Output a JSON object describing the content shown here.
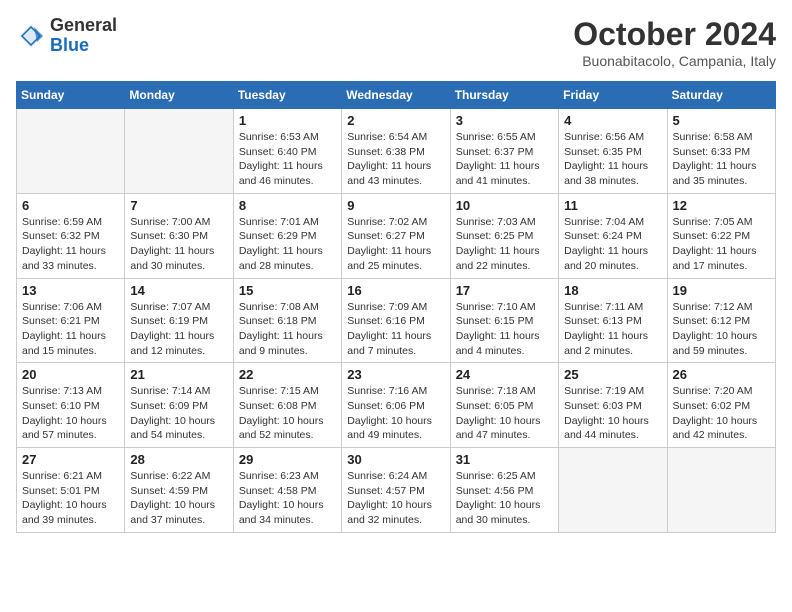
{
  "header": {
    "logo_general": "General",
    "logo_blue": "Blue",
    "month": "October 2024",
    "location": "Buonabitacolo, Campania, Italy"
  },
  "weekdays": [
    "Sunday",
    "Monday",
    "Tuesday",
    "Wednesday",
    "Thursday",
    "Friday",
    "Saturday"
  ],
  "weeks": [
    [
      {
        "day": "",
        "info": ""
      },
      {
        "day": "",
        "info": ""
      },
      {
        "day": "1",
        "info": "Sunrise: 6:53 AM\nSunset: 6:40 PM\nDaylight: 11 hours and 46 minutes."
      },
      {
        "day": "2",
        "info": "Sunrise: 6:54 AM\nSunset: 6:38 PM\nDaylight: 11 hours and 43 minutes."
      },
      {
        "day": "3",
        "info": "Sunrise: 6:55 AM\nSunset: 6:37 PM\nDaylight: 11 hours and 41 minutes."
      },
      {
        "day": "4",
        "info": "Sunrise: 6:56 AM\nSunset: 6:35 PM\nDaylight: 11 hours and 38 minutes."
      },
      {
        "day": "5",
        "info": "Sunrise: 6:58 AM\nSunset: 6:33 PM\nDaylight: 11 hours and 35 minutes."
      }
    ],
    [
      {
        "day": "6",
        "info": "Sunrise: 6:59 AM\nSunset: 6:32 PM\nDaylight: 11 hours and 33 minutes."
      },
      {
        "day": "7",
        "info": "Sunrise: 7:00 AM\nSunset: 6:30 PM\nDaylight: 11 hours and 30 minutes."
      },
      {
        "day": "8",
        "info": "Sunrise: 7:01 AM\nSunset: 6:29 PM\nDaylight: 11 hours and 28 minutes."
      },
      {
        "day": "9",
        "info": "Sunrise: 7:02 AM\nSunset: 6:27 PM\nDaylight: 11 hours and 25 minutes."
      },
      {
        "day": "10",
        "info": "Sunrise: 7:03 AM\nSunset: 6:25 PM\nDaylight: 11 hours and 22 minutes."
      },
      {
        "day": "11",
        "info": "Sunrise: 7:04 AM\nSunset: 6:24 PM\nDaylight: 11 hours and 20 minutes."
      },
      {
        "day": "12",
        "info": "Sunrise: 7:05 AM\nSunset: 6:22 PM\nDaylight: 11 hours and 17 minutes."
      }
    ],
    [
      {
        "day": "13",
        "info": "Sunrise: 7:06 AM\nSunset: 6:21 PM\nDaylight: 11 hours and 15 minutes."
      },
      {
        "day": "14",
        "info": "Sunrise: 7:07 AM\nSunset: 6:19 PM\nDaylight: 11 hours and 12 minutes."
      },
      {
        "day": "15",
        "info": "Sunrise: 7:08 AM\nSunset: 6:18 PM\nDaylight: 11 hours and 9 minutes."
      },
      {
        "day": "16",
        "info": "Sunrise: 7:09 AM\nSunset: 6:16 PM\nDaylight: 11 hours and 7 minutes."
      },
      {
        "day": "17",
        "info": "Sunrise: 7:10 AM\nSunset: 6:15 PM\nDaylight: 11 hours and 4 minutes."
      },
      {
        "day": "18",
        "info": "Sunrise: 7:11 AM\nSunset: 6:13 PM\nDaylight: 11 hours and 2 minutes."
      },
      {
        "day": "19",
        "info": "Sunrise: 7:12 AM\nSunset: 6:12 PM\nDaylight: 10 hours and 59 minutes."
      }
    ],
    [
      {
        "day": "20",
        "info": "Sunrise: 7:13 AM\nSunset: 6:10 PM\nDaylight: 10 hours and 57 minutes."
      },
      {
        "day": "21",
        "info": "Sunrise: 7:14 AM\nSunset: 6:09 PM\nDaylight: 10 hours and 54 minutes."
      },
      {
        "day": "22",
        "info": "Sunrise: 7:15 AM\nSunset: 6:08 PM\nDaylight: 10 hours and 52 minutes."
      },
      {
        "day": "23",
        "info": "Sunrise: 7:16 AM\nSunset: 6:06 PM\nDaylight: 10 hours and 49 minutes."
      },
      {
        "day": "24",
        "info": "Sunrise: 7:18 AM\nSunset: 6:05 PM\nDaylight: 10 hours and 47 minutes."
      },
      {
        "day": "25",
        "info": "Sunrise: 7:19 AM\nSunset: 6:03 PM\nDaylight: 10 hours and 44 minutes."
      },
      {
        "day": "26",
        "info": "Sunrise: 7:20 AM\nSunset: 6:02 PM\nDaylight: 10 hours and 42 minutes."
      }
    ],
    [
      {
        "day": "27",
        "info": "Sunrise: 6:21 AM\nSunset: 5:01 PM\nDaylight: 10 hours and 39 minutes."
      },
      {
        "day": "28",
        "info": "Sunrise: 6:22 AM\nSunset: 4:59 PM\nDaylight: 10 hours and 37 minutes."
      },
      {
        "day": "29",
        "info": "Sunrise: 6:23 AM\nSunset: 4:58 PM\nDaylight: 10 hours and 34 minutes."
      },
      {
        "day": "30",
        "info": "Sunrise: 6:24 AM\nSunset: 4:57 PM\nDaylight: 10 hours and 32 minutes."
      },
      {
        "day": "31",
        "info": "Sunrise: 6:25 AM\nSunset: 4:56 PM\nDaylight: 10 hours and 30 minutes."
      },
      {
        "day": "",
        "info": ""
      },
      {
        "day": "",
        "info": ""
      }
    ]
  ]
}
